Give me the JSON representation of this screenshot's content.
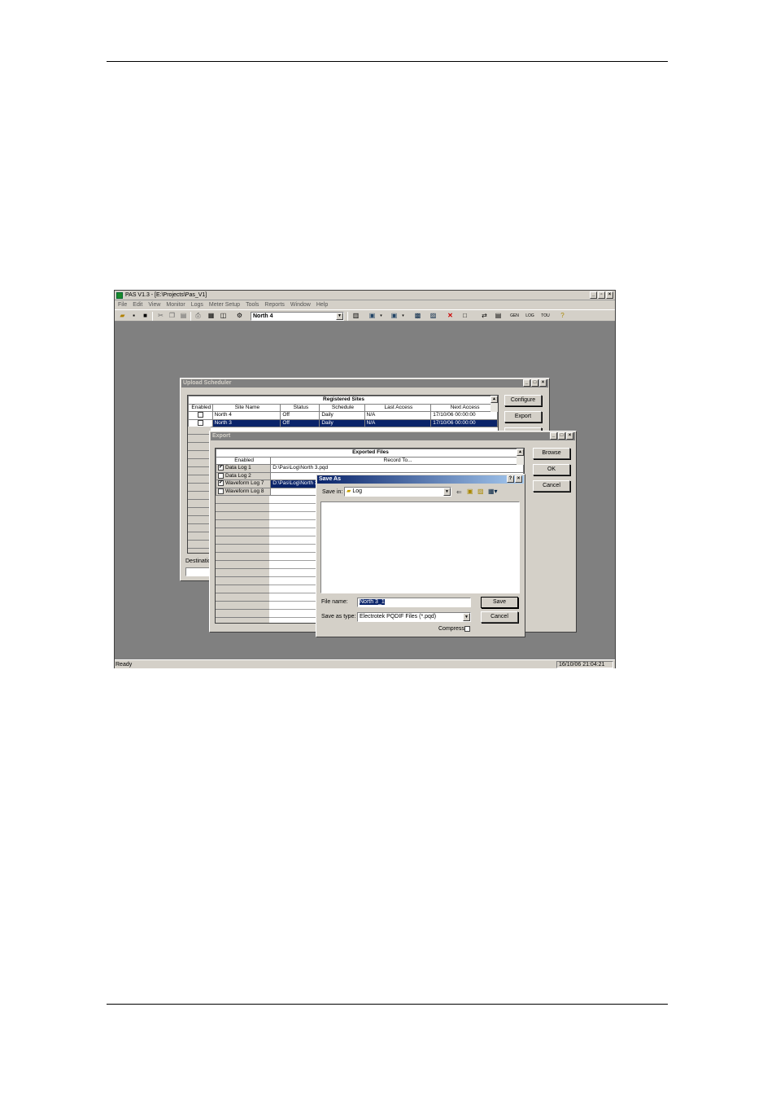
{
  "app": {
    "title": "PAS V1.3 - [E:\\Projects\\Pas_V1]",
    "menu": [
      "File",
      "Edit",
      "View",
      "Monitor",
      "Logs",
      "Meter Setup",
      "Tools",
      "Reports",
      "Window",
      "Help"
    ],
    "site_combo_value": "North 4",
    "status_left": "Ready",
    "status_clock": "16/10/06 21:04:21"
  },
  "upload_scheduler": {
    "title": "Upload Scheduler",
    "table_title": "Registered Sites",
    "columns": [
      "Enabled",
      "Site Name",
      "Status",
      "Schedule",
      "Last Access",
      "Next Access"
    ],
    "rows": [
      {
        "site": "North 4",
        "status": "Off",
        "schedule": "Daily",
        "last": "N/A",
        "next": "17/10/06 00:00:00"
      },
      {
        "site": "North 3",
        "status": "Off",
        "schedule": "Daily",
        "last": "N/A",
        "next": "17/10/06 00:00:00"
      }
    ],
    "configure_label": "Configure",
    "export_label": "Export",
    "destination_label": "Destinatio"
  },
  "export": {
    "title": "Export",
    "table_title": "Exported Files",
    "columns": [
      "Enabled",
      "Record To..."
    ],
    "rows": [
      {
        "name": "Data Log 1",
        "checked": true,
        "path": "D:\\Pas\\Log\\North 3.pqd"
      },
      {
        "name": "Data Log 2",
        "checked": false,
        "path": ""
      },
      {
        "name": "Waveform Log 7",
        "checked": true,
        "path": "D:\\Pas\\Log\\North 3"
      },
      {
        "name": "Waveform Log 8",
        "checked": false,
        "path": ""
      }
    ],
    "browse_label": "Browse",
    "ok_label": "OK",
    "cancel_label": "Cancel"
  },
  "save_as": {
    "title": "Save As",
    "save_in_label": "Save in:",
    "save_in_value": "Log",
    "file_name_label": "File name:",
    "file_name_value": "North 3_1",
    "save_type_label": "Save as type:",
    "save_type_value": "Electrotek PQDIF Files (*.pqd)",
    "compress_label": "Compress",
    "save_label": "Save",
    "cancel_label": "Cancel"
  }
}
